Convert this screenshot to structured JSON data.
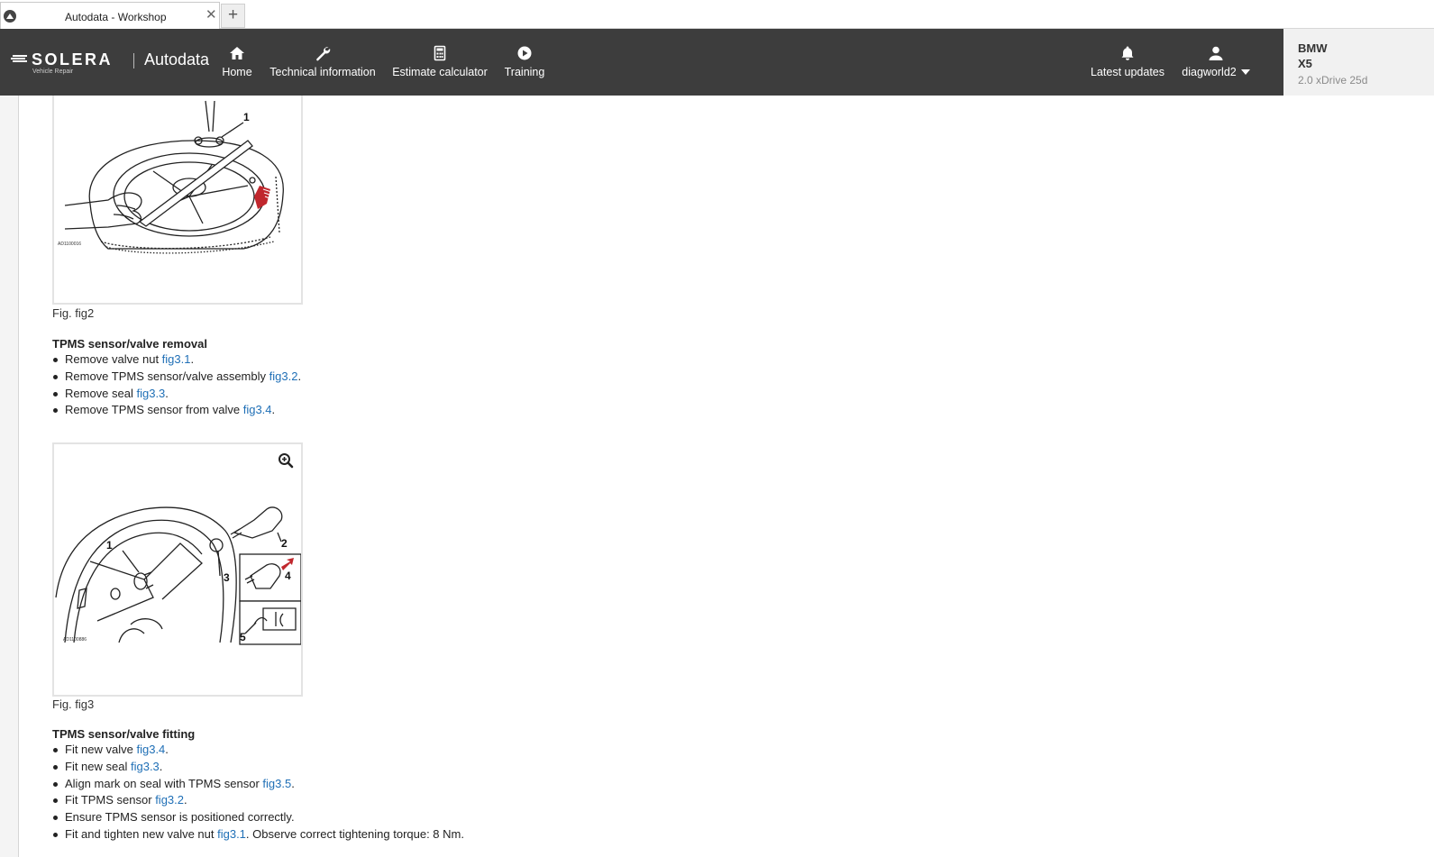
{
  "browser": {
    "tab_title": "Autodata - Workshop",
    "close_glyph": "✕",
    "new_tab_glyph": "+"
  },
  "header": {
    "brand": {
      "name": "SOLERA",
      "subtitle": "Vehicle Repair",
      "product": "Autodata"
    },
    "nav": {
      "home": {
        "label": "Home",
        "icon": "home-icon"
      },
      "technical": {
        "label": "Technical information",
        "icon": "wrench-icon"
      },
      "estimate": {
        "label": "Estimate calculator",
        "icon": "calculator-icon"
      },
      "training": {
        "label": "Training",
        "icon": "play-icon"
      },
      "updates": {
        "label": "Latest updates",
        "icon": "bell-icon"
      },
      "user": {
        "label": "diagworld2",
        "icon": "user-icon"
      }
    },
    "vehicle": {
      "make": "BMW",
      "model": "X5",
      "variant": "2.0 xDrive 25d"
    },
    "colors": {
      "navbar": "#3d3d3d",
      "link": "#1f6fb6",
      "accent_red": "#c0272d"
    }
  },
  "content": {
    "fig2": {
      "caption": "Fig. fig2",
      "callouts": [
        "1"
      ],
      "ref_code": "AD1100016"
    },
    "removal": {
      "title": "TPMS sensor/valve removal",
      "steps": [
        {
          "text": "Remove valve nut ",
          "link": "fig3.1",
          "tail": "."
        },
        {
          "text": "Remove TPMS sensor/valve assembly ",
          "link": "fig3.2",
          "tail": "."
        },
        {
          "text": "Remove seal ",
          "link": "fig3.3",
          "tail": "."
        },
        {
          "text": "Remove TPMS sensor from valve ",
          "link": "fig3.4",
          "tail": "."
        }
      ]
    },
    "fig3": {
      "caption": "Fig. fig3",
      "callouts": [
        "1",
        "2",
        "3",
        "4",
        "5"
      ],
      "ref_code": "AD1100886"
    },
    "fitting": {
      "title": "TPMS sensor/valve fitting",
      "steps": [
        {
          "text": "Fit new valve ",
          "link": "fig3.4",
          "tail": "."
        },
        {
          "text": "Fit new seal ",
          "link": "fig3.3",
          "tail": "."
        },
        {
          "text": "Align mark on seal with TPMS sensor ",
          "link": "fig3.5",
          "tail": "."
        },
        {
          "text": "Fit TPMS sensor ",
          "link": "fig3.2",
          "tail": "."
        },
        {
          "text": "Ensure TPMS sensor is positioned correctly.",
          "link": "",
          "tail": ""
        },
        {
          "text": "Fit and tighten new valve nut ",
          "link": "fig3.1",
          "tail": ". Observe correct tightening torque: 8 Nm."
        }
      ]
    }
  }
}
